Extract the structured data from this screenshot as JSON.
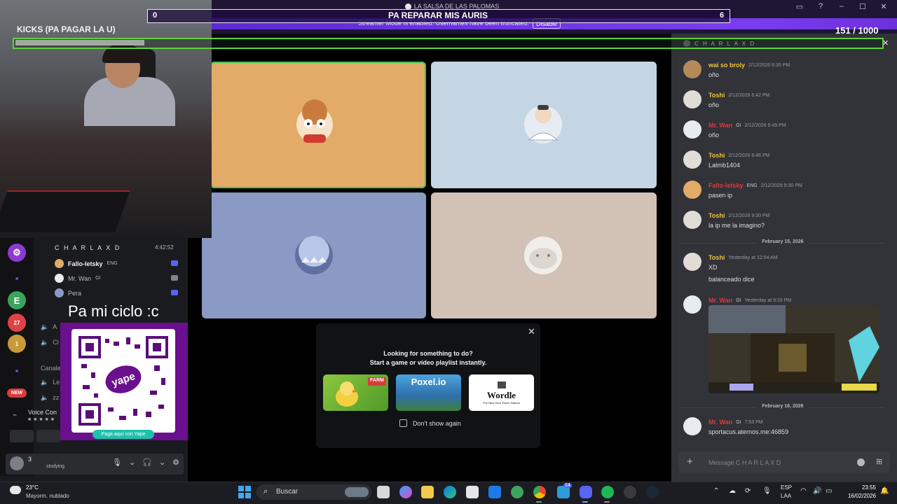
{
  "window": {
    "title": "LA SALSA DE LAS PALOMAS",
    "streamer_notice": "Streamer Mode is enabled. Usernames have been truncated.",
    "disable_label": "Disable"
  },
  "goal": {
    "left_value": "0",
    "title": "PA REPARAR MIS AURIS",
    "right_value": "6",
    "count": "151  / 1000"
  },
  "webcam": {
    "kicks_label": "KICKS (PA PAGAR LA U)"
  },
  "voice_panel": {
    "channel_title": "C H A R L A  X D",
    "elapsed": "4:42:52",
    "members": [
      {
        "name": "Fallo-letsky",
        "tag": "ENG"
      },
      {
        "name": "Mr. Wan",
        "tag": "GI"
      },
      {
        "name": "Pera",
        "tag": ""
      }
    ],
    "channel_rows": [
      "A",
      "Cl",
      "Le",
      "zz"
    ],
    "category_label": "Canale",
    "voice_connected": "Voice Con",
    "new_badge": "NEW",
    "guild_badges": [
      "27",
      "1"
    ],
    "user": {
      "name": "3",
      "status": "studying"
    }
  },
  "overlay": {
    "donation_text": "Pa mi ciclo :c",
    "yape_logo": "yape",
    "yape_cta": "Paga aquí con Yape"
  },
  "stage": {
    "tiles": [
      {
        "bg": "#e3ab68",
        "speaking": true
      },
      {
        "bg": "#c4d6e4",
        "speaking": false
      },
      {
        "bg": "#8b9ac4",
        "speaking": false
      },
      {
        "bg": "#d2c2b6",
        "speaking": false
      }
    ]
  },
  "activity": {
    "line1": "Looking for something to do?",
    "line2": "Start a game or video playlist instantly.",
    "games": [
      "FARM",
      "Poxel.io",
      "Wordle"
    ],
    "wordle_sub": "The New York Times Games",
    "dont_show": "Don't show again"
  },
  "chat": {
    "header": "C H A R L A  X D",
    "messages": [
      {
        "author": "wai so broly",
        "color": "#f0c33c",
        "tag": "",
        "time": "2/12/2026 6:35 PM",
        "lines": [
          "oño"
        ]
      },
      {
        "author": "Toshi",
        "color": "#f0c33c",
        "tag": "",
        "time": "2/12/2026 6:42 PM",
        "lines": [
          "oño"
        ]
      },
      {
        "author": "Mr. Wan",
        "color": "#d83c3e",
        "tag": "GI",
        "time": "2/12/2026 6:49 PM",
        "lines": [
          "oño"
        ]
      },
      {
        "author": "Toshi",
        "color": "#f0c33c",
        "tag": "",
        "time": "2/12/2026 8:46 PM",
        "lines": [
          "Latmb1404"
        ]
      },
      {
        "author": "Fallo-letsky",
        "color": "#d83c3e",
        "tag": "ENG",
        "time": "2/12/2026 9:30 PM",
        "lines": [
          "pasen ip"
        ]
      },
      {
        "author": "Toshi",
        "color": "#f0c33c",
        "tag": "",
        "time": "2/12/2026 9:30 PM",
        "lines": [
          "la ip me la imagino?"
        ]
      },
      {
        "author": "Toshi",
        "color": "#f0c33c",
        "tag": "",
        "time": "Yesterday at 12:04 AM",
        "lines": [
          "XD",
          "balanceado dice"
        ]
      },
      {
        "author": "Mr. Wan",
        "color": "#d83c3e",
        "tag": "GI",
        "time": "Yesterday at 9:33 PM",
        "lines": []
      },
      {
        "author": "Mr. Wan",
        "color": "#d83c3e",
        "tag": "GI",
        "time": "7:53 PM",
        "lines": [
          "sportacus.aternos.me:46859"
        ]
      }
    ],
    "dividers": [
      "February 15, 2026",
      "February 16, 2026"
    ],
    "input_placeholder": "Message C H A R L A  X D"
  },
  "taskbar": {
    "temperature": "23°C",
    "weather": "Mayorm. nublado",
    "search_label": "Buscar",
    "badge_count": "14",
    "lang1": "ESP",
    "lang2": "LAA",
    "time": "23:55",
    "date": "16/02/2026"
  }
}
